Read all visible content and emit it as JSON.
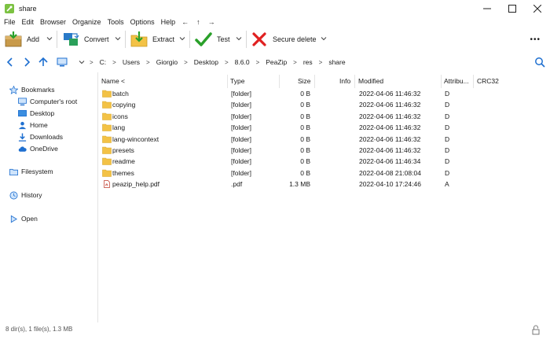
{
  "window": {
    "title": "share"
  },
  "menu": [
    "File",
    "Edit",
    "Browser",
    "Organize",
    "Tools",
    "Options",
    "Help"
  ],
  "menu_arrows": [
    "←",
    "↑",
    "→"
  ],
  "toolbar": {
    "add_label": "Add",
    "convert_label": "Convert",
    "extract_label": "Extract",
    "test_label": "Test",
    "secure_delete_label": "Secure delete",
    "more": "•••"
  },
  "address": {
    "crumbs": [
      "C:",
      "Users",
      "Giorgio",
      "Desktop",
      "8.6.0",
      "PeaZip",
      "res",
      "share"
    ]
  },
  "sidebar": {
    "bookmarks": "Bookmarks",
    "items": [
      "Computer's root",
      "Desktop",
      "Home",
      "Downloads",
      "OneDrive"
    ],
    "filesystem": "Filesystem",
    "history": "History",
    "open": "Open"
  },
  "columns": {
    "name": "Name <",
    "type": "Type",
    "size": "Size",
    "info": "Info",
    "modified": "Modified",
    "attributes": "Attribu...",
    "crc": "CRC32"
  },
  "rows": [
    {
      "name": "batch",
      "type": "[folder]",
      "size": "0 B",
      "modified": "2022-04-06 11:46:32",
      "attr": "D",
      "kind": "folder"
    },
    {
      "name": "copying",
      "type": "[folder]",
      "size": "0 B",
      "modified": "2022-04-06 11:46:32",
      "attr": "D",
      "kind": "folder"
    },
    {
      "name": "icons",
      "type": "[folder]",
      "size": "0 B",
      "modified": "2022-04-06 11:46:32",
      "attr": "D",
      "kind": "folder"
    },
    {
      "name": "lang",
      "type": "[folder]",
      "size": "0 B",
      "modified": "2022-04-06 11:46:32",
      "attr": "D",
      "kind": "folder"
    },
    {
      "name": "lang-wincontext",
      "type": "[folder]",
      "size": "0 B",
      "modified": "2022-04-06 11:46:32",
      "attr": "D",
      "kind": "folder"
    },
    {
      "name": "presets",
      "type": "[folder]",
      "size": "0 B",
      "modified": "2022-04-06 11:46:32",
      "attr": "D",
      "kind": "folder"
    },
    {
      "name": "readme",
      "type": "[folder]",
      "size": "0 B",
      "modified": "2022-04-06 11:46:34",
      "attr": "D",
      "kind": "folder"
    },
    {
      "name": "themes",
      "type": "[folder]",
      "size": "0 B",
      "modified": "2022-04-08 21:08:04",
      "attr": "D",
      "kind": "folder"
    },
    {
      "name": "peazip_help.pdf",
      "type": ".pdf",
      "size": "1.3 MB",
      "modified": "2022-04-10 17:24:46",
      "attr": "A",
      "kind": "pdf"
    }
  ],
  "status": {
    "text": "8 dir(s), 1 file(s), 1.3 MB"
  },
  "colors": {
    "accent_blue": "#1e6fd0",
    "folder": "#f3c246",
    "check": "#2aa02a",
    "delete": "#e02020"
  }
}
